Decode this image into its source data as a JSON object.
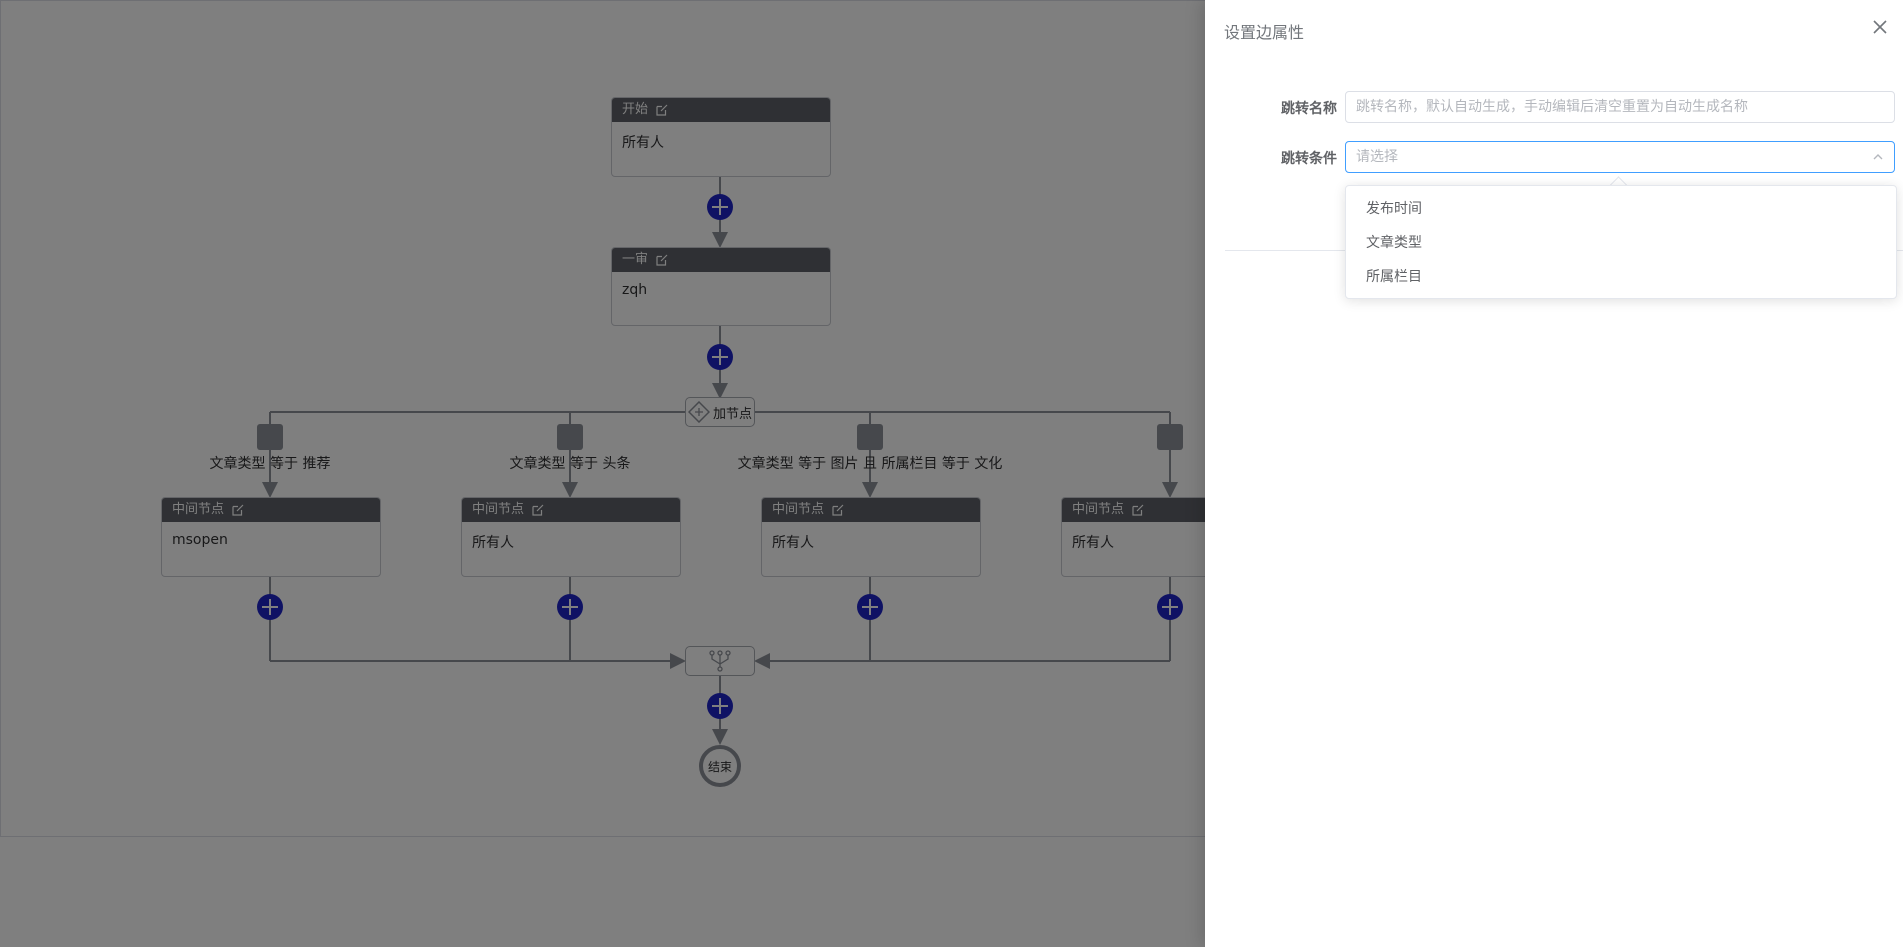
{
  "flow": {
    "start_node": {
      "title": "开始",
      "body": "所有人"
    },
    "review_node": {
      "title": "一审",
      "body": "zqh"
    },
    "gateway_label": "加节点",
    "branches": [
      {
        "condition": "文章类型 等于 推荐",
        "node_title": "中间节点",
        "node_body": "msopen"
      },
      {
        "condition": "文章类型 等于 头条",
        "node_title": "中间节点",
        "node_body": "所有人"
      },
      {
        "condition": "文章类型 等于 图片 且 所属栏目 等于 文化",
        "node_title": "中间节点",
        "node_body": "所有人"
      },
      {
        "condition": "",
        "node_title": "中间节点",
        "node_body": "所有人"
      }
    ],
    "end_label": "结束"
  },
  "drawer": {
    "title": "设置边属性",
    "name_label": "跳转名称",
    "name_placeholder": "跳转名称，默认自动生成，手动编辑后清空重置为自动生成名称",
    "condition_label": "跳转条件",
    "condition_placeholder": "请选择",
    "options": [
      "发布时间",
      "文章类型",
      "所属栏目"
    ]
  },
  "colors": {
    "accent": "#409eff",
    "plus_button": "#1f24c9",
    "node_header": "#5e6168",
    "overlay": "rgba(0,0,0,0.5)"
  },
  "icons": [
    "edit-icon",
    "plus-icon",
    "branch-icon",
    "gateway-diamond-icon",
    "merge-icon",
    "close-icon",
    "chevron-up-icon"
  ]
}
